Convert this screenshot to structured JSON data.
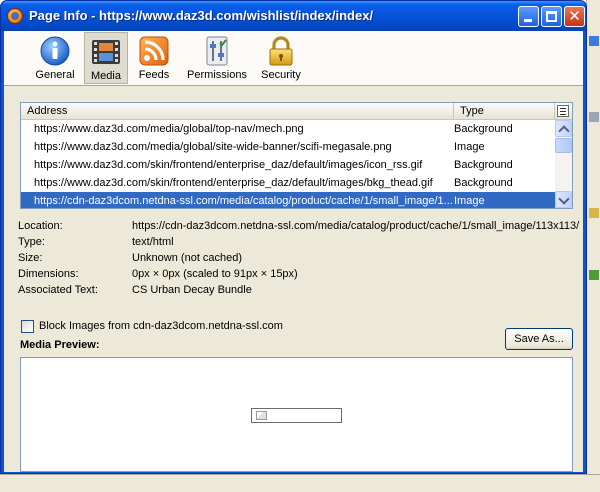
{
  "window": {
    "title": "Page Info - https://www.daz3d.com/wishlist/index/index/",
    "app_icon": "firefox-icon",
    "buttons": {
      "minimize_icon": "minimize-icon",
      "maximize_icon": "maximize-icon",
      "close_icon": "close-icon",
      "close_glyph": "✕"
    }
  },
  "toolbar": {
    "tabs": [
      {
        "label": "General",
        "icon": "info-icon",
        "active": false
      },
      {
        "label": "Media",
        "icon": "media-film-icon",
        "active": true
      },
      {
        "label": "Feeds",
        "icon": "rss-feed-icon",
        "active": false
      },
      {
        "label": "Permissions",
        "icon": "permissions-sliders-icon",
        "active": false
      },
      {
        "label": "Security",
        "icon": "padlock-icon",
        "active": false
      }
    ]
  },
  "media_list": {
    "columns": {
      "address": "Address",
      "type": "Type"
    },
    "rows": [
      {
        "address": "https://www.daz3d.com/media/global/top-nav/mech.png",
        "type": "Background",
        "selected": false
      },
      {
        "address": "https://www.daz3d.com/media/global/site-wide-banner/scifi-megasale.png",
        "type": "Image",
        "selected": false
      },
      {
        "address": "https://www.daz3d.com/skin/frontend/enterprise_daz/default/images/icon_rss.gif",
        "type": "Background",
        "selected": false
      },
      {
        "address": "https://www.daz3d.com/skin/frontend/enterprise_daz/default/images/bkg_thead.gif",
        "type": "Background",
        "selected": false
      },
      {
        "address": "https://cdn-daz3dcom.netdna-ssl.com/media/catalog/product/cache/1/small_image/1...",
        "type": "Image",
        "selected": true
      }
    ]
  },
  "details": {
    "location": {
      "label": "Location:",
      "value": "https://cdn-daz3dcom.netdna-ssl.com/media/catalog/product/cache/1/small_image/113x113/"
    },
    "type": {
      "label": "Type:",
      "value": "text/html"
    },
    "size": {
      "label": "Size:",
      "value": "Unknown (not cached)"
    },
    "dimensions": {
      "label": "Dimensions:",
      "value": "0px × 0px (scaled to 91px × 15px)"
    },
    "associated_text": {
      "label": "Associated Text:",
      "value": "CS Urban Decay Bundle"
    }
  },
  "block_images": {
    "label": "Block Images from cdn-daz3dcom.netdna-ssl.com",
    "checked": false
  },
  "save_as": {
    "label": "Save As..."
  },
  "preview": {
    "label": "Media Preview:",
    "broken_image_icon": "broken-image-icon"
  },
  "colors": {
    "title_bar": "#0553dc",
    "selection": "#316ac5",
    "dialog_bg": "#ece9d8"
  }
}
